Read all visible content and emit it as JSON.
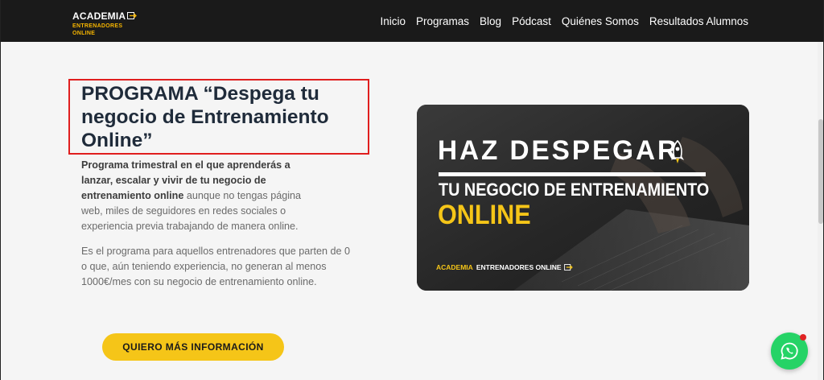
{
  "header": {
    "logo": {
      "top": "ACADEMIA",
      "bottom": "ENTRENADORES ONLINE"
    },
    "nav": [
      "Inicio",
      "Programas",
      "Blog",
      "Pódcast",
      "Quiénes Somos",
      "Resultados Alumnos"
    ]
  },
  "main": {
    "title": "PROGRAMA “Despega tu negocio de Entrenamiento Online”",
    "desc1_bold": "Programa trimestral en el que aprenderás a lanzar, escalar y vivir de tu negocio de entrenamiento online",
    "desc1_rest": " aunque no tengas página web, miles de seguidores en redes sociales o experiencia previa trabajando de manera online.",
    "desc2": "Es el programa para aquellos entrenadores que parten de 0 o que, aún teniendo experiencia, no generan al menos 1000€/mes con su negocio de entrenamiento online.",
    "cta": "QUIERO MÁS INFORMACIÓN"
  },
  "hero": {
    "line1": "HAZ DESPEGAR",
    "line2": "TU NEGOCIO DE ENTRENAMIENTO",
    "line3": "ONLINE",
    "footer_yellow": "ACADEMIA",
    "footer_white": "ENTRENADORES ONLINE"
  },
  "colors": {
    "accent": "#f5c518",
    "header_bg": "#1a1a1a",
    "title": "#1f2b3a",
    "highlight_box": "#e01e1e",
    "whatsapp": "#25d366"
  },
  "icons": [
    "rocket-icon",
    "whatsapp-icon",
    "logo-mark-icon"
  ]
}
